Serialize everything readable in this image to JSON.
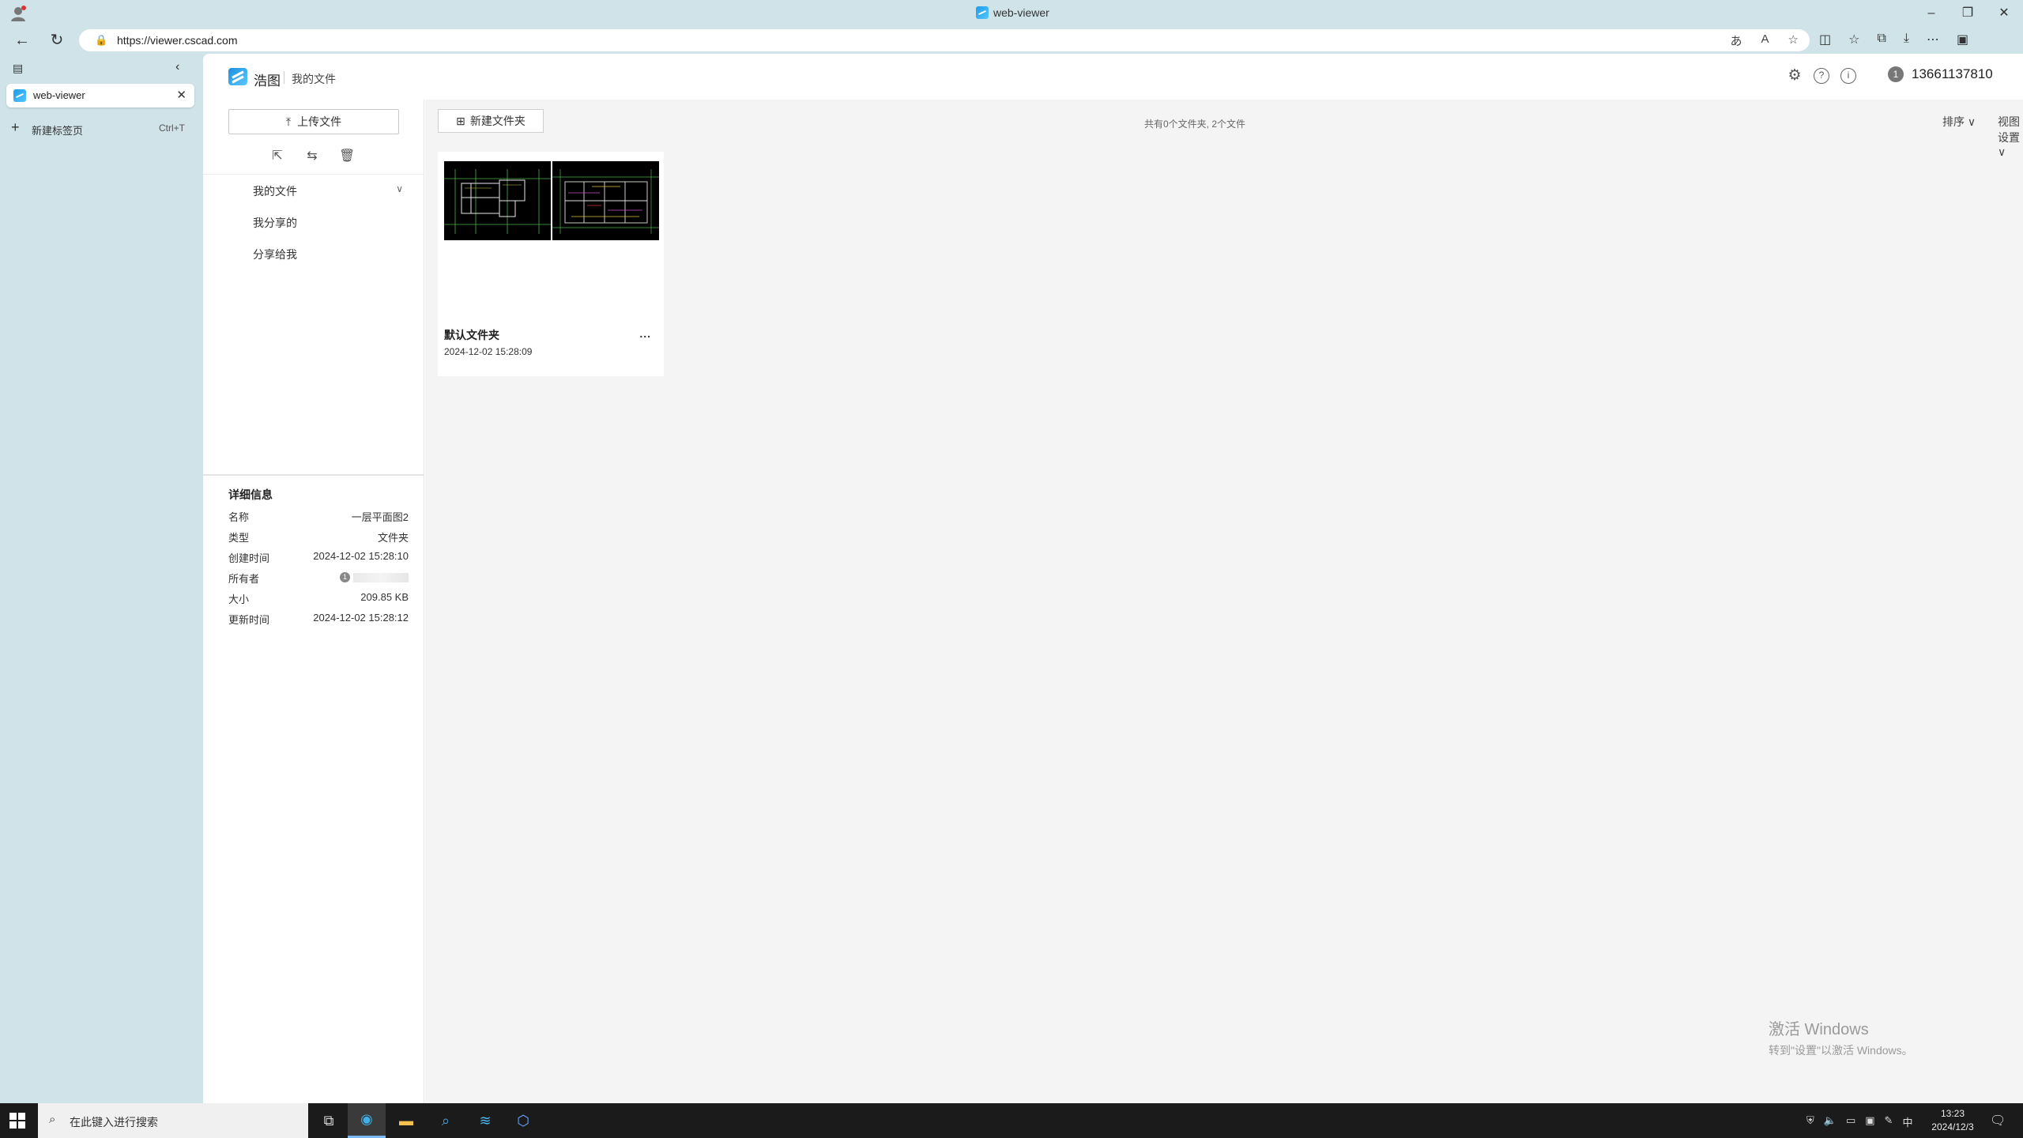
{
  "browser": {
    "window_title": "web-viewer",
    "url": "https://viewer.cscad.com",
    "tab_label": "web-viewer",
    "new_tab_label": "新建标签页",
    "new_tab_shortcut": "Ctrl+T"
  },
  "app": {
    "brand": "浩图",
    "breadcrumb": "我的文件",
    "user_initial": "1",
    "user_name": "13661137810"
  },
  "sidebar": {
    "upload_label": "上传文件",
    "nav": [
      "我的文件",
      "我分享的",
      "分享给我"
    ]
  },
  "details": {
    "title": "详细信息",
    "rows": [
      {
        "key": "名称",
        "value": "一层平面图2"
      },
      {
        "key": "类型",
        "value": "文件夹"
      },
      {
        "key": "创建时间",
        "value": "2024-12-02 15:28:10"
      },
      {
        "key": "所有者",
        "value": ""
      },
      {
        "key": "大小",
        "value": "209.85 KB"
      },
      {
        "key": "更新时间",
        "value": "2024-12-02 15:28:12"
      }
    ],
    "owner_initial": "1"
  },
  "main": {
    "new_folder_label": "新建文件夹",
    "count_text": "共有0个文件夹, 2个文件",
    "sort_label": "排序",
    "view_label": "视图设置",
    "folder": {
      "name": "默认文件夹",
      "date": "2024-12-02 15:28:09",
      "more": "..."
    }
  },
  "watermark": {
    "line1": "激活 Windows",
    "line2": "转到\"设置\"以激活 Windows。"
  },
  "taskbar": {
    "search_placeholder": "在此键入进行搜索",
    "time": "13:23",
    "date": "2024/12/3",
    "ime": "中"
  }
}
